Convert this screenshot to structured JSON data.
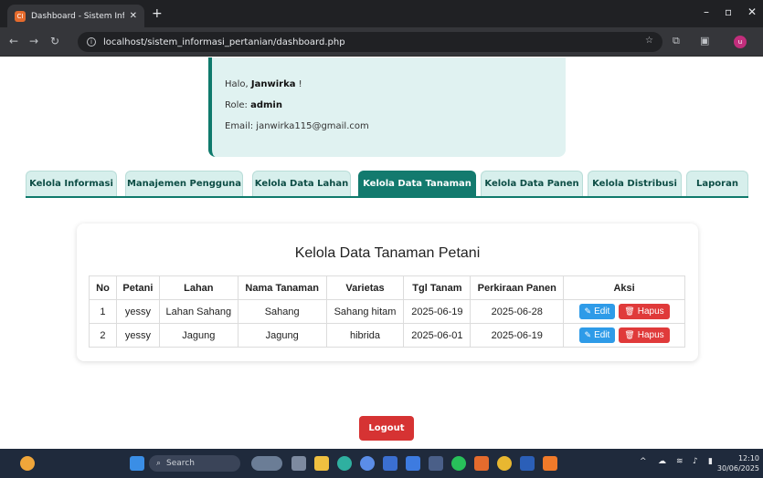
{
  "browser": {
    "tab_title": "Dashboard - Sistem Informasi F",
    "tab_favicon": "CI",
    "url": "localhost/sistem_informasi_pertanian/dashboard.php",
    "avatar_letter": "u"
  },
  "user": {
    "greeting": "Halo, ",
    "name": "Janwirka",
    "greeting_suffix": " !",
    "role_label": "Role: ",
    "role": "admin",
    "email_label": "Email: ",
    "email": "janwirka115@gmail.com"
  },
  "tabs": [
    {
      "label": "Kelola Informasi",
      "active": false
    },
    {
      "label": "Manajemen Pengguna",
      "active": false
    },
    {
      "label": "Kelola Data Lahan",
      "active": false
    },
    {
      "label": "Kelola Data Tanaman",
      "active": true
    },
    {
      "label": "Kelola Data Panen",
      "active": false
    },
    {
      "label": "Kelola Distribusi",
      "active": false
    },
    {
      "label": "Laporan",
      "active": false
    }
  ],
  "card": {
    "title": "Kelola Data Tanaman Petani",
    "columns": [
      "No",
      "Petani",
      "Lahan",
      "Nama Tanaman",
      "Varietas",
      "Tgl Tanam",
      "Perkiraan Panen",
      "Aksi"
    ],
    "rows": [
      [
        "1",
        "yessy",
        "Lahan Sahang",
        "Sahang",
        "Sahang hitam",
        "2025-06-19",
        "2025-06-28"
      ],
      [
        "2",
        "yessy",
        "Jagung",
        "Jagung",
        "hibrida",
        "2025-06-01",
        "2025-06-19"
      ]
    ],
    "edit_label": "Edit",
    "delete_label": "Hapus"
  },
  "logout_label": "Logout",
  "taskbar": {
    "search_label": "Search",
    "time": "12:10",
    "date": "30/06/2025"
  },
  "colors": {
    "primary": "#137a6e",
    "tab_bg": "#d7efec",
    "edit": "#2e9be8",
    "delete": "#e03a3a"
  }
}
